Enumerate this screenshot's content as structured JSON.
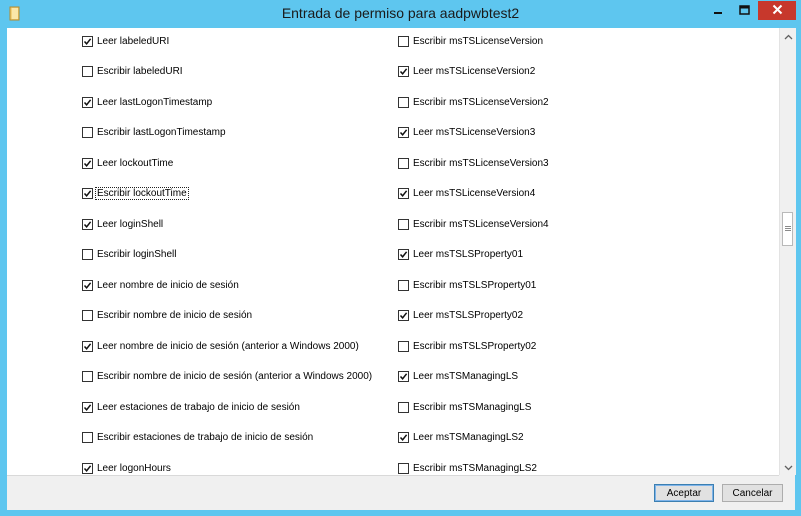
{
  "window": {
    "title": "Entrada de permiso para aadpwbtest2",
    "icon": "folder-icon",
    "controls": [
      "minimize-icon",
      "maximize-icon",
      "close-icon"
    ]
  },
  "left_column": [
    {
      "label": "Leer labeledURI",
      "checked": true
    },
    {
      "label": "Escribir labeledURI",
      "checked": false
    },
    {
      "label": "Leer lastLogonTimestamp",
      "checked": true
    },
    {
      "label": "Escribir lastLogonTimestamp",
      "checked": false
    },
    {
      "label": "Leer lockoutTime",
      "checked": true
    },
    {
      "label": "Escribir lockoutTime",
      "checked": true,
      "focused": true
    },
    {
      "label": "Leer loginShell",
      "checked": true
    },
    {
      "label": "Escribir loginShell",
      "checked": false
    },
    {
      "label": "Leer nombre de inicio de sesión",
      "checked": true
    },
    {
      "label": "Escribir nombre de inicio de sesión",
      "checked": false
    },
    {
      "label": "Leer nombre de inicio de sesión (anterior a Windows 2000)",
      "checked": true
    },
    {
      "label": "Escribir nombre de inicio de sesión (anterior a Windows 2000)",
      "checked": false
    },
    {
      "label": "Leer estaciones de trabajo de inicio de sesión",
      "checked": true
    },
    {
      "label": "Escribir estaciones de trabajo de inicio de sesión",
      "checked": false
    },
    {
      "label": "Leer logonHours",
      "checked": true
    }
  ],
  "right_column": [
    {
      "label": "Escribir msTSLicenseVersion",
      "checked": false
    },
    {
      "label": "Leer msTSLicenseVersion2",
      "checked": true
    },
    {
      "label": "Escribir msTSLicenseVersion2",
      "checked": false
    },
    {
      "label": "Leer msTSLicenseVersion3",
      "checked": true
    },
    {
      "label": "Escribir msTSLicenseVersion3",
      "checked": false
    },
    {
      "label": "Leer msTSLicenseVersion4",
      "checked": true
    },
    {
      "label": "Escribir msTSLicenseVersion4",
      "checked": false
    },
    {
      "label": "Leer msTSLSProperty01",
      "checked": true
    },
    {
      "label": "Escribir msTSLSProperty01",
      "checked": false
    },
    {
      "label": "Leer msTSLSProperty02",
      "checked": true
    },
    {
      "label": "Escribir msTSLSProperty02",
      "checked": false
    },
    {
      "label": "Leer msTSManagingLS",
      "checked": true
    },
    {
      "label": "Escribir msTSManagingLS",
      "checked": false
    },
    {
      "label": "Leer msTSManagingLS2",
      "checked": true
    },
    {
      "label": "Escribir msTSManagingLS2",
      "checked": false
    }
  ],
  "buttons": {
    "ok_label": "Aceptar",
    "cancel_label": "Cancelar"
  },
  "scrollbar": {
    "position": 0.44
  },
  "colors": {
    "titlebar": "#5ec6ef",
    "close_button": "#c7382c",
    "focus_button_border": "#3c7fb1"
  }
}
